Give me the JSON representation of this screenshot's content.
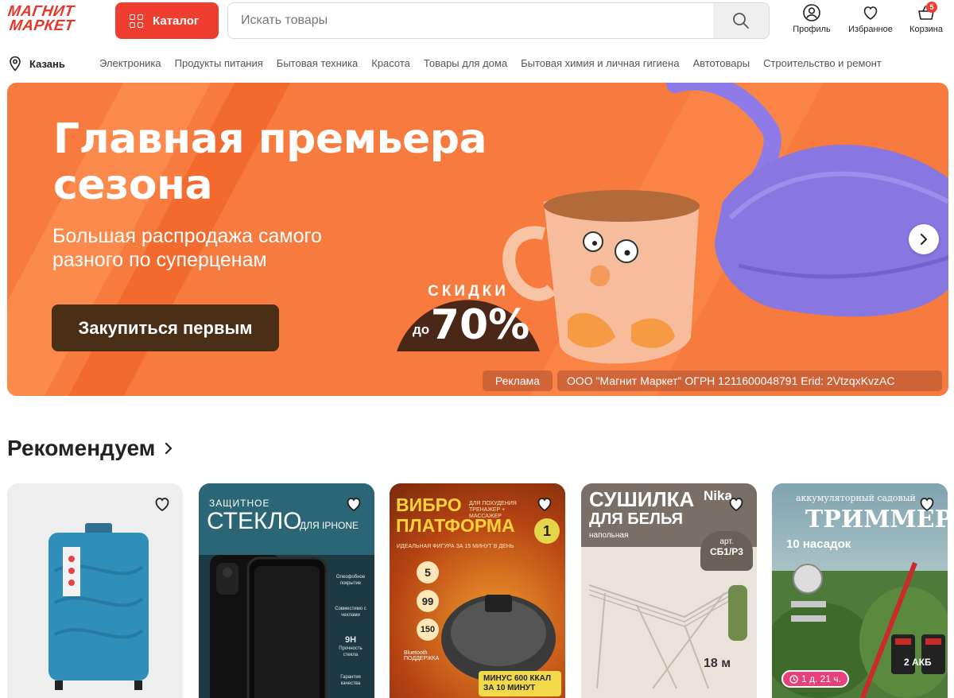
{
  "header": {
    "logo_line1": "МАГНИТ",
    "logo_line2": "МАРКЕТ",
    "catalog_label": "Каталог",
    "search_placeholder": "Искать товары",
    "profile_label": "Профиль",
    "favorites_label": "Избранное",
    "cart_label": "Корзина",
    "cart_count": "5",
    "accent_color": "#ef3e2f"
  },
  "nav": {
    "city": "Казань",
    "categories": [
      "Электроника",
      "Продукты питания",
      "Бытовая техника",
      "Красота",
      "Товары для дома",
      "Бытовая химия и личная гигиена",
      "Автотовары",
      "Строительство и ремонт"
    ]
  },
  "banner": {
    "title_line1": "Главная премьера",
    "title_line2": "сезона",
    "subtitle_line1": "Большая распродажа самого",
    "subtitle_line2": "разного по суперценам",
    "button": "Закупиться первым",
    "sale_word": "СКИДКИ",
    "sale_prefix": "до",
    "sale_value": "70%",
    "ad_label": "Реклама",
    "ad_info": "ООО \"Магнит Маркет\" ОГРН 1211600048791 Erid: 2VtzqxKvzAC",
    "bg_color": "#f77a3e"
  },
  "recommend": {
    "title": "Рекомендуем",
    "cards": [
      {
        "kind": "suitcase"
      },
      {
        "kind": "glass",
        "line1": "ЗАЩИТНОЕ",
        "line2": "СТЕКЛО",
        "line3": "ДЛЯ IPHONE",
        "feat1": "Олеофобное покрытие",
        "feat2": "Совместимо с чехлами",
        "feat3": "9H",
        "feat3b": "Прочность стекла",
        "feat4": "Гарантия качества"
      },
      {
        "kind": "vibro",
        "line1": "ВИБРО",
        "line2": "ПЛАТФОРМА",
        "tag": "ДЛЯ ПОХУДЕНИЯ ТРЕНАЖЕР + МАССАЖЕР",
        "sub": "ИДЕАЛЬНАЯ ФИГУРА ЗА 15 МИНУТ В ДЕНЬ",
        "num1": "5",
        "num2": "99",
        "num3": "150",
        "bt": "Bluetooth ПОДДЕРЖКА",
        "promo": "МИНУС 600 ККАЛ ЗА 10 МИНУТ",
        "rank": "1"
      },
      {
        "kind": "dryer",
        "line1": "СУШИЛКА",
        "line2": "ДЛЯ БЕЛЬЯ",
        "line3": "напольная",
        "brand": "Nika",
        "art_label": "арт.",
        "art": "СБ1/Р3",
        "length": "18 м"
      },
      {
        "kind": "trimmer",
        "top": "аккумуляторный садовый",
        "line1": "ТРИММЕР",
        "line2": "10 насадок",
        "akb": "2 АКБ",
        "timer": "1 д. 21 ч."
      }
    ]
  }
}
